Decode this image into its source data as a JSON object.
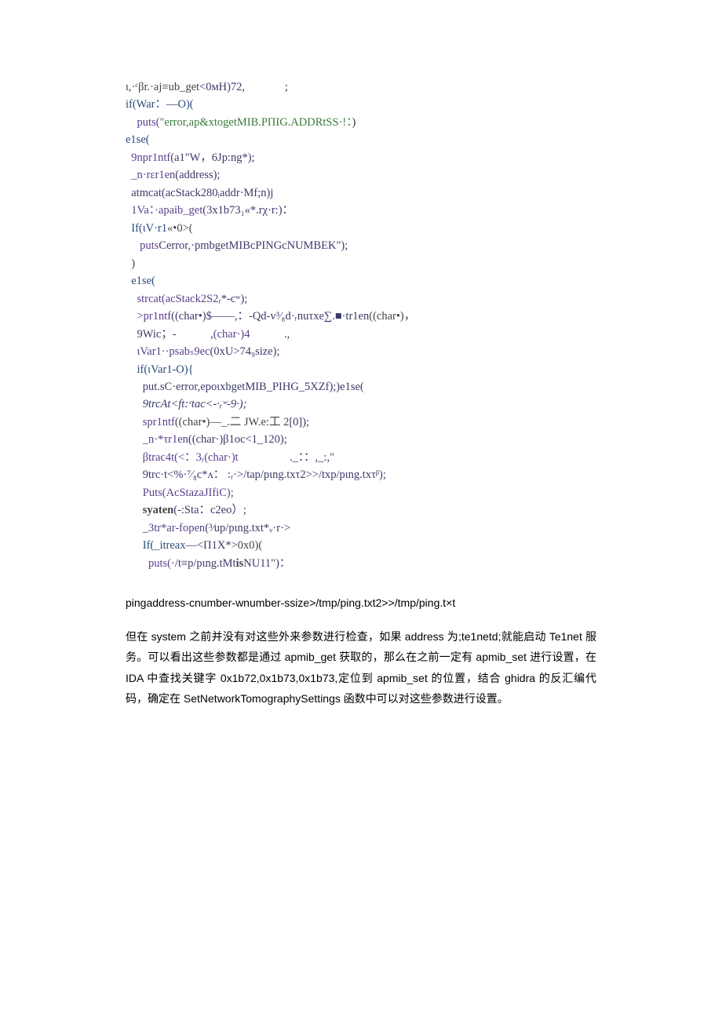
{
  "code": {
    "l1a": "ι,·ᶜβr.·aj≡ub_get",
    "l1b": "<0ᴍH)72,",
    "l1c": "              ;",
    "l2a": "if(War：—O)(",
    "l3a": "    puts(",
    "l3b": "\"error,ap&xtogetMIB.PΠIG.ADDRtSS·!：",
    "l3c": ")",
    "l4a": "e1se(",
    "l5a": "  9npr1ntf",
    "l5b": "(a1\"W，6Jp:ng*);",
    "l6a": "  _n·rεr1en",
    "l6b": "(address);",
    "l7a": "  atmcat(acStack280ᵢaddr·Mf;n)j",
    "l8a": "  1Va：·apaib_get",
    "l8b": "(3x1b73₁«*.rχ·r:)：",
    "l9a": "  If(ιV·r1",
    "l9b": "«•0>(",
    "l10a": "     puts",
    "l10b": "Cerror,·pmbgetMIBcPINGcNUMBEK\");",
    "l11a": "  )",
    "l12a": "  e1se(",
    "l13a": "    strcat(acStack2S2ᵣ",
    "l13b": "*-cʷ);",
    "l14a": "    >pr1ntf",
    "l14b": "((char•)$——,：-Qd-v³⁄₈d·ᵣnuτxe∑.■·tr1en",
    "l14c": "((char•)，",
    "l15a": "    9Wic；-            ,",
    "l15b": "(char·)4",
    "l15c": "            .,",
    "l16a": "    ιVar1··psabₛ9ec",
    "l16b": "(0xU>74₉size);",
    "l17a": "    if(ιVar1-O){",
    "l18a": "      put.sC·error,epoιxbgetMIB_PIHG_5XZf);)e1se(",
    "l19a": "      9trcAt<ft:ᶜtac<-·ᵣʷ-9·);",
    "l20a": "      spr1ntf",
    "l20b": "((char•)—_.二 JW.e:工 2",
    "l20c": "[0]);",
    "l21a": "      _n·*τr1en",
    "l21b": "((char·)β1oc<1_120);",
    "l22a": "      βtrac4t(<：3ᵣ(char·)t",
    "l22b": "                  ._：：,_:,\"",
    "l23a": "      9trc·t<%·⁷⁄₈c*ᴧ： :ᵣ·>/tap/pιng.txτ2>>/txp/pιng.txτᵝ);",
    "l24a": "      Puts(AcStazaJIfiC);",
    "l25a": "      syaten",
    "l25b": "(-:Sta：c2eo）;",
    "l26a": "      _3tr*ar-fopen",
    "l26b": "(³⁄up/pιng.txt*ᵥ·r·>",
    "l27a": "      If(_itreax",
    "l27b": "—<Π1X*",
    "l27c": ">0x0)(",
    "l28a": "        puts(·",
    "l28b": "/t≡p/pιng.tMt",
    "l28c": "is",
    "l28d": "NU11\")："
  },
  "caption": "pingaddress-cnumber-wnumber-ssize>/tmp/ping.txt2>>/tmp/ping.t×t",
  "para": "但在 system 之前并没有对这些外来参数进行检查，如果 address 为;te1netd;就能启动 Te1net 服务。可以看出这些参数都是通过 apmib_get 获取的，那么在之前一定有 apmib_set 进行设置，在 IDA 中查找关键字 0x1b72,0x1b73,0x1b73,定位到 apmib_set 的位置，结合 ghidra 的反汇编代码，确定在 SetNetworkTomographySettings 函数中可以对这些参数进行设置。"
}
